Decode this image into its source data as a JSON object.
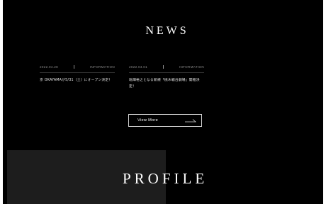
{
  "news": {
    "title": "NEWS",
    "items": [
      {
        "date": "2022.04.28",
        "category": "INFORMATION",
        "text": "京 OKAYAMAが5/31（土）にオープン決定！"
      },
      {
        "date": "2022.04.01",
        "category": "INFORMATION",
        "text": "堀畑裕之となる新規「桃木戦台劇場」開催決定！"
      }
    ],
    "view_more_label": "View More",
    "view_more_icon": "long-arrow-right-icon"
  },
  "profile": {
    "title": "PROFILE"
  },
  "colors": {
    "background": "#000000",
    "text": "#ffffff",
    "meta": "#8c8c8c",
    "panel": "#1d1d1d"
  }
}
